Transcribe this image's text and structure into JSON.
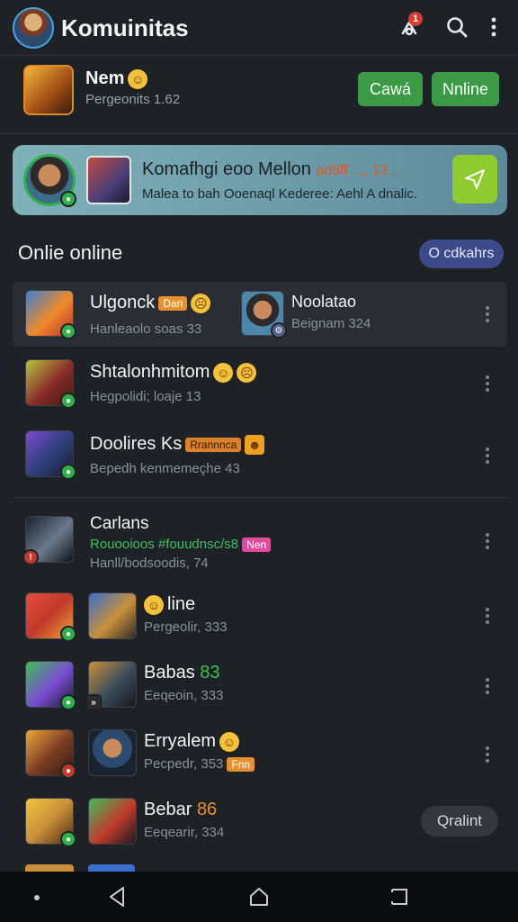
{
  "header": {
    "title": "Komuinitas",
    "notif_count": "1",
    "colors": {
      "accent": "#4aa3d8",
      "badge": "#d93b30"
    }
  },
  "group": {
    "name": "Nem",
    "subtitle": "Pergeonits 1.62",
    "btn_primary": "Cawá",
    "btn_secondary": "Nnline"
  },
  "banner": {
    "title": "Komafhgi eoo Mellon",
    "title_highlight": "ad8ff ..., 13...",
    "subtitle": "Malea to bah Ooenaql Kederee: Aehl A dnalic.",
    "send_icon": "send-icon"
  },
  "section": {
    "title": "Onlie online",
    "pill": "O cdkahrs"
  },
  "rows": [
    {
      "name": "Ulgonck",
      "tag": "Dan",
      "sub": "Hanleaolo soas 33",
      "side_name": "Noolatao",
      "side_sub": "Beignam 324"
    },
    {
      "name": "Shtalonhmitom",
      "sub": "Hegpolidi; loaje 13"
    },
    {
      "name": "Doolires Ks",
      "tag": "Rrannnca",
      "sub": "Bepedh kenmemeçhe 43"
    },
    {
      "name": "Carlans",
      "sub_green": "Rouooioos #fouudnsc/s8",
      "tag": "Nen",
      "sub": "Hanll/bodsoodis, 74"
    },
    {
      "name": "line",
      "sub": "Pergeolir, 333"
    },
    {
      "name": "Babas",
      "name_extra": "83",
      "sub": "Eeqeoin, 333"
    },
    {
      "name": "Erryalem",
      "sub": "Pecpedr, 353",
      "tag": "Fnn"
    },
    {
      "name": "Bebar",
      "name_extra": "86",
      "sub": "Eeqearir, 334",
      "action": "Qralint"
    }
  ]
}
